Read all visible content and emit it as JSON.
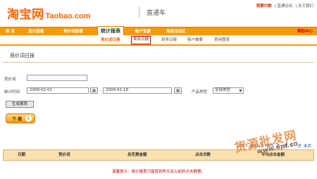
{
  "header": {
    "logo_cn": "淘宝网",
    "logo_en": "Taobao.com",
    "product": "直通车",
    "top_links": {
      "recharge": "我要付款",
      "forum": "| 直通论坛",
      "about": "| 关于我们"
    }
  },
  "nav": {
    "items": [
      {
        "label": "首 页"
      },
      {
        "label": "宝贝管理"
      },
      {
        "label": "竞价词管理"
      },
      {
        "label": "统计报表"
      },
      {
        "label": "帐户设置"
      },
      {
        "label": "淘宝活动区"
      }
    ],
    "help": "帮助中心"
  },
  "subnav": {
    "items": [
      {
        "label": "竞价词日报"
      },
      {
        "label": "类目日报"
      },
      {
        "label": "财务日报"
      },
      {
        "label": "账户概要"
      },
      {
        "label": "常用图表"
      }
    ]
  },
  "section": {
    "title": "竞价词日报"
  },
  "form": {
    "keyword_label": "竞价词",
    "keyword_value": "",
    "time_label": "统计时间",
    "start_date": "2009-02-01",
    "date_sep": "-",
    "end_date": "2009-02-19",
    "product_type_label": "产品类型",
    "product_type_value": "全部类型",
    "generate_label": "生成报表"
  },
  "download": {
    "label": "下 载",
    "icon_glyph": "⇩"
  },
  "pager": {
    "total": "共0个",
    "page_info": "第0/0页",
    "first": "首页",
    "prev": "上一页",
    "next": "下一页",
    "last": "末页"
  },
  "table": {
    "headers": [
      "日期",
      "竞价词",
      "总花费金额",
      "点击次数",
      "平均点击金额"
    ]
  },
  "hint": {
    "text": "温馨提示：统计报表只能查到昨天及以前的点击数据。"
  },
  "watermark": {
    "cn": "货源批发网",
    "url": "www.6pf.cn"
  }
}
